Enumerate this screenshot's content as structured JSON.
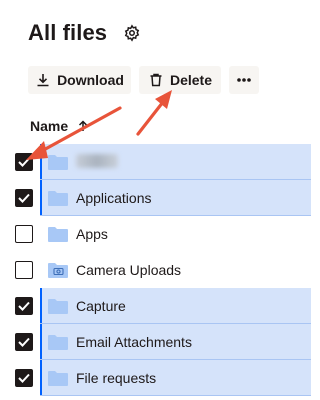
{
  "page": {
    "title": "All files"
  },
  "toolbar": {
    "download_label": "Download",
    "delete_label": "Delete",
    "more_label": "•••"
  },
  "table": {
    "name_header": "Name",
    "sort": "ascending",
    "rows": [
      {
        "name": "",
        "redacted": true,
        "selected": true,
        "checked": true,
        "icon": "folder-icon"
      },
      {
        "name": "Applications",
        "selected": true,
        "checked": true,
        "icon": "folder-icon"
      },
      {
        "name": "Apps",
        "selected": false,
        "checked": false,
        "icon": "folder-icon"
      },
      {
        "name": "Camera Uploads",
        "selected": false,
        "checked": false,
        "icon": "camera-folder-icon"
      },
      {
        "name": "Capture",
        "selected": true,
        "checked": true,
        "icon": "folder-icon"
      },
      {
        "name": "Email Attachments",
        "selected": true,
        "checked": true,
        "icon": "folder-icon"
      },
      {
        "name": "File requests",
        "selected": true,
        "checked": true,
        "icon": "folder-icon"
      }
    ]
  },
  "annotations": {
    "arrow_color": "#e8543a"
  },
  "colors": {
    "selection": "#d5e3fa",
    "accent": "#0061fe",
    "button_bg": "#f7f5f2",
    "folder": "#a8c8f6"
  }
}
